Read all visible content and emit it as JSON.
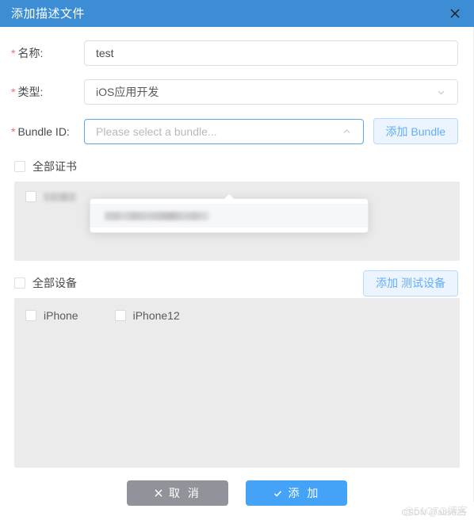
{
  "dialog": {
    "title": "添加描述文件",
    "close_icon": "close-icon",
    "header_color": "#3c8dd4"
  },
  "form": {
    "required_mark": "*",
    "fields": [
      {
        "label": "名称:",
        "value": "test",
        "placeholder": ""
      },
      {
        "label": "类型:",
        "value": "iOS应用开发",
        "placeholder": ""
      },
      {
        "label": "Bundle ID:",
        "value": "",
        "placeholder": "Please select a bundle..."
      }
    ],
    "add_bundle_button": "添加 Bundle"
  },
  "bundle_dropdown": {
    "visible": true,
    "items": [
      {
        "label": "",
        "redacted": true,
        "width": 132
      }
    ]
  },
  "certificates": {
    "select_all_label": "全部证书",
    "select_all_checked": false,
    "items": [
      {
        "label": "",
        "redacted": true,
        "checked": false,
        "width": 42
      }
    ]
  },
  "devices": {
    "select_all_label": "全部设备",
    "select_all_checked": false,
    "add_device_button": "添加 测试设备",
    "items": [
      {
        "label": "iPhone",
        "checked": false
      },
      {
        "label": "iPhone12",
        "checked": false
      }
    ]
  },
  "footer": {
    "cancel_label": "取 消",
    "cancel_icon": "cross-icon",
    "submit_label": "添 加",
    "submit_icon": "check-icon",
    "cancel_color": "#909399",
    "submit_color": "#44a3f7"
  },
  "watermarks": {
    "primary": "@51CTO博客",
    "secondary": "CSDN @abs625"
  }
}
